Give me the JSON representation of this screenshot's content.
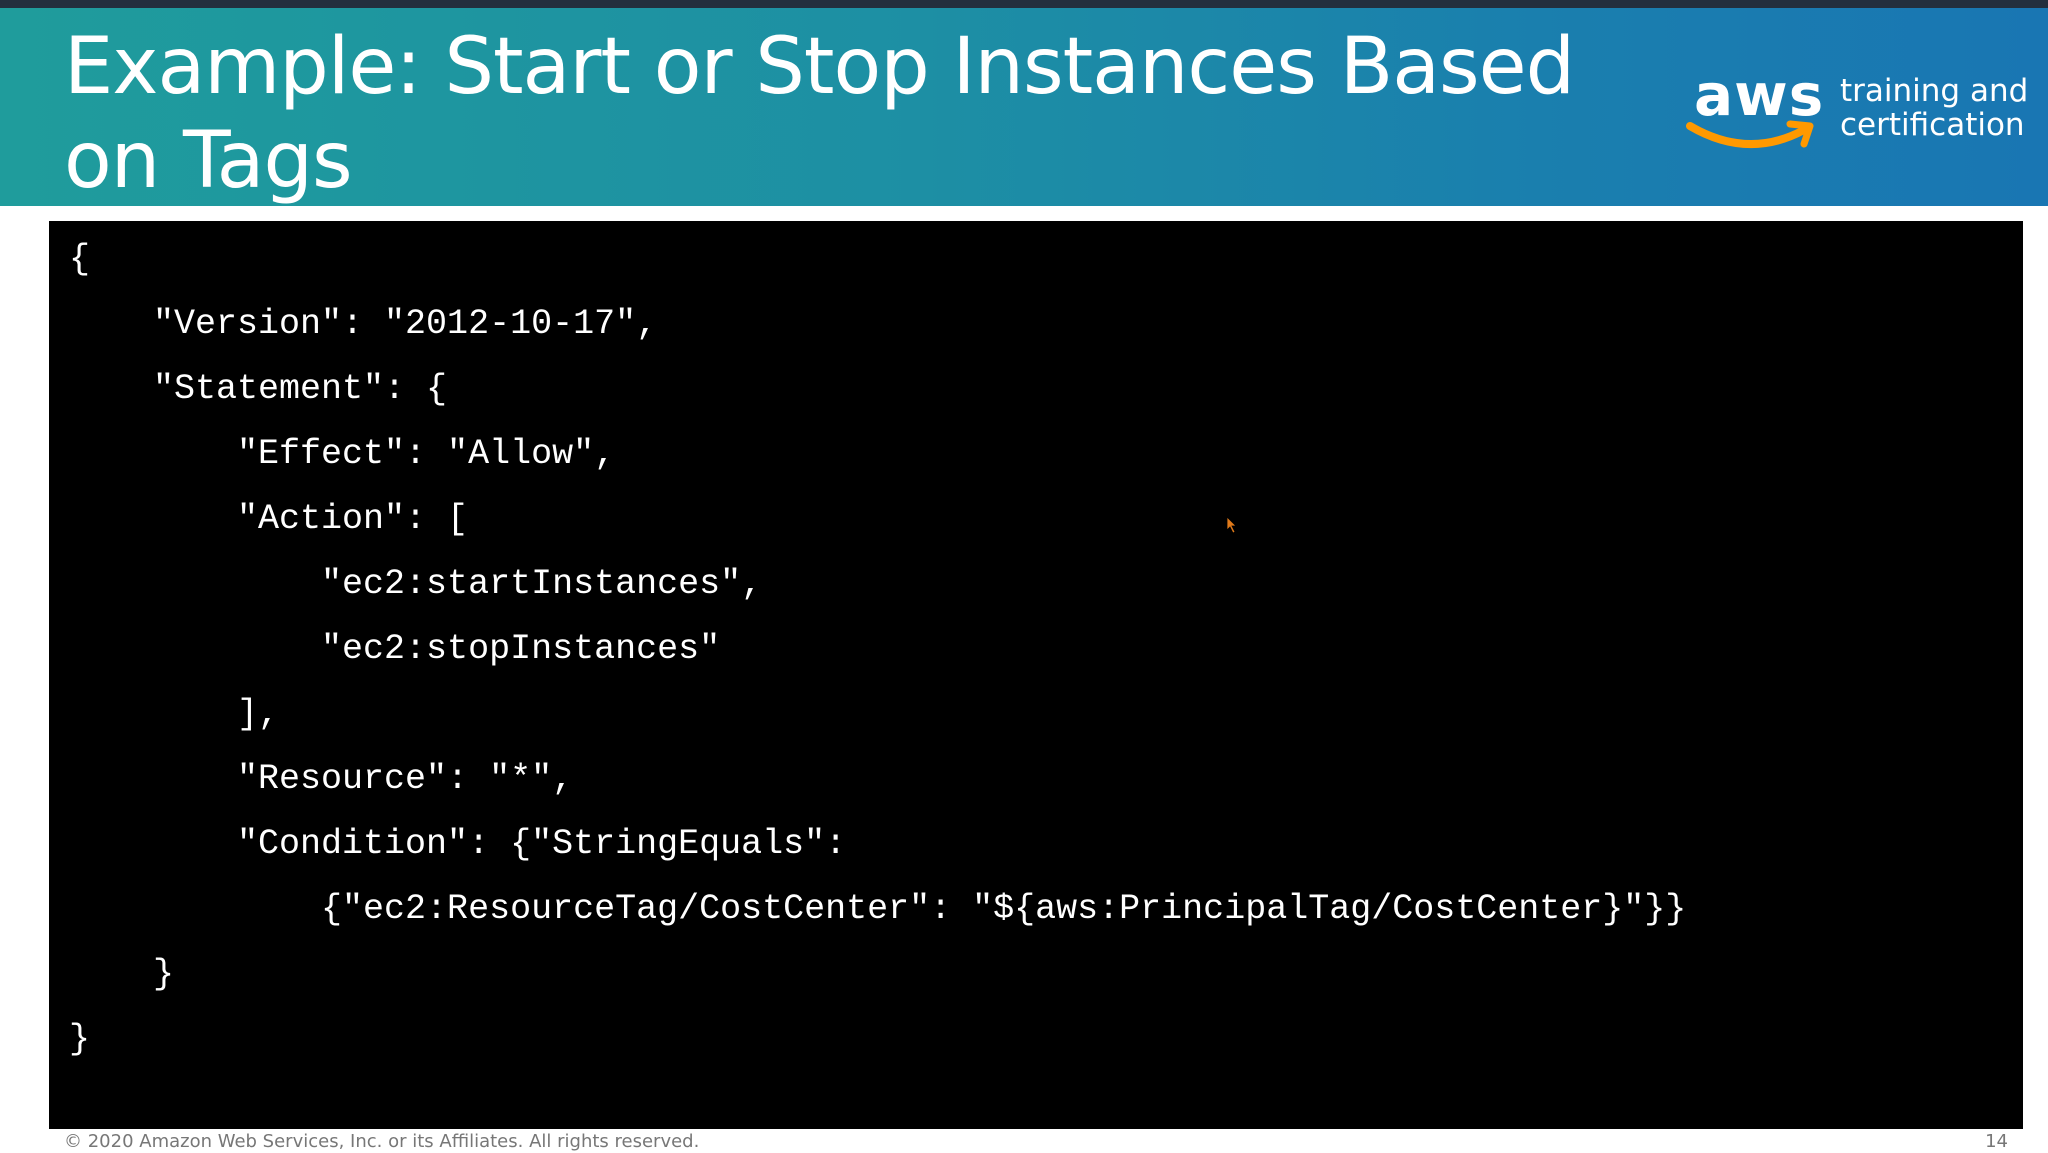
{
  "slide": {
    "title": "Example: Start or Stop Instances Based on Tags",
    "logo": {
      "mark_text": "aws",
      "tagline_line1": "training and",
      "tagline_line2": "certification",
      "brand_color": "#ff9900"
    },
    "colors": {
      "header_start": "#1f9c9c",
      "header_end": "#1976b3",
      "code_background": "#000000",
      "code_text": "#ffffff"
    },
    "code_lines": [
      "{",
      "    \"Version\": \"2012-10-17\",",
      "    \"Statement\": {",
      "        \"Effect\": \"Allow\",",
      "        \"Action\": [",
      "            \"ec2:startInstances\",",
      "            \"ec2:stopInstances\"",
      "        ],",
      "        \"Resource\": \"*\",",
      "        \"Condition\": {\"StringEquals\":",
      "            {\"ec2:ResourceTag/CostCenter\": \"${aws:PrincipalTag/CostCenter}\"}}",
      "    }",
      "}"
    ],
    "footer": {
      "copyright": "© 2020 Amazon Web Services, Inc. or its Affiliates. All rights reserved.",
      "page_number": "14"
    },
    "icons": {
      "cursor": "mouse-pointer-icon"
    }
  }
}
